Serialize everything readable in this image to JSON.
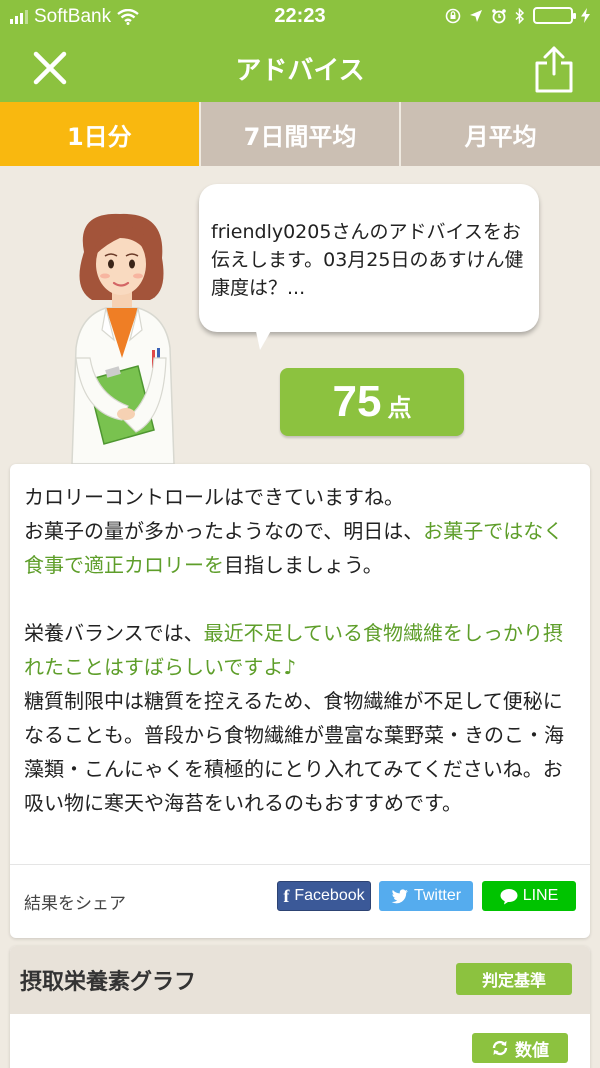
{
  "status_bar": {
    "carrier": "SoftBank",
    "time": "22:23"
  },
  "nav": {
    "title": "アドバイス",
    "close_icon": "close-icon",
    "share_icon": "share-icon"
  },
  "tabs": [
    {
      "label": "1日分",
      "active": true
    },
    {
      "label": "7日間平均",
      "active": false
    },
    {
      "label": "月平均",
      "active": false
    }
  ],
  "advisor": {
    "bubble_text": "friendly0205さんのアドバイスをお伝えします。03月25日のあすけん健康度は？...",
    "score": "75",
    "score_unit": "点"
  },
  "advice": {
    "p1_a": "カロリーコントロールはできていますね。",
    "p1_b": "お菓子の量が多かったようなので、明日は、",
    "p1_hl": "お菓子ではなく食事で適正カロリーを",
    "p1_c": "目指しましょう。",
    "p2_a": "栄養バランスでは、",
    "p2_hl": "最近不足している食物繊維をしっかり摂れたことはすばらしいですよ♪",
    "p2_b": "糖質制限中は糖質を控えるため、食物繊維が不足して便秘になることも。普段から食物繊維が豊富な葉野菜・きのこ・海藻類・こんにゃくを積極的にとり入れてみてくださいね。お吸い物に寒天や海苔をいれるのもおすすめです。"
  },
  "share": {
    "label": "結果をシェア",
    "facebook": "Facebook",
    "twitter": "Twitter",
    "line": "LINE"
  },
  "graph": {
    "title": "摂取栄養素グラフ",
    "criteria_button": "判定基準",
    "values_button": "数値"
  },
  "colors": {
    "brand_green": "#8cc23f",
    "active_tab": "#f9b80f",
    "highlight_text": "#5e9e2a",
    "facebook": "#3b5998",
    "twitter": "#55acee",
    "line": "#00c300"
  }
}
